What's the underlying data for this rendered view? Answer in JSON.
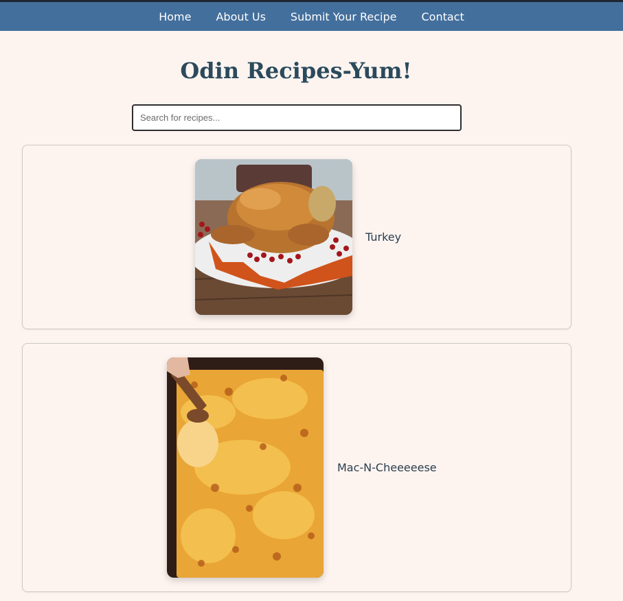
{
  "nav": {
    "links": [
      "Home",
      "About Us",
      "Submit Your Recipe",
      "Contact"
    ]
  },
  "header": {
    "title": "Odin Recipes-Yum!"
  },
  "search": {
    "placeholder": "Search for recipes...",
    "value": ""
  },
  "recipes": [
    {
      "name": "Turkey",
      "image": "roast-turkey-photo"
    },
    {
      "name": "Mac-N-Cheeeeese",
      "image": "mac-and-cheese-photo"
    }
  ],
  "colors": {
    "nav_bg": "#436f9c",
    "page_bg": "#fdf4f0",
    "title": "#2b4a5c"
  }
}
